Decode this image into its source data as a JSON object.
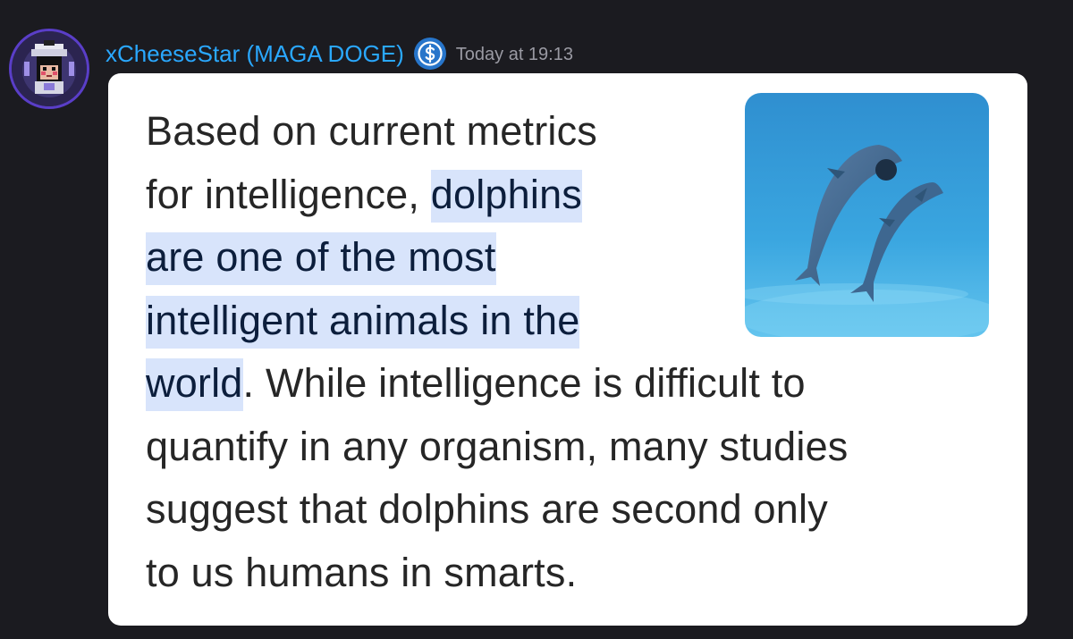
{
  "message": {
    "author": "xCheeseStar (MAGA DOGE)",
    "badge_icon": "usdc-dollar-badge-icon",
    "timestamp": "Today at 19:13",
    "avatar_icon": "pixel-astronaut-avatar-icon"
  },
  "snippet": {
    "line1": "Based on current metrics",
    "line2_plain": "for intelligence, ",
    "line2_hl": "dolphins",
    "line3_hl": "are one of the most",
    "line4_hl": "intelligent animals in the",
    "line5_hl": "world",
    "line5_plain": ". While intelligence is difficult to",
    "line6": "quantify in any organism, many studies",
    "line7": "suggest that dolphins are second only",
    "line8": "to us humans in smarts.",
    "image_icon": "dolphins-photo",
    "highlight_color": "#d8e4fb"
  },
  "colors": {
    "background": "#1b1b20",
    "username": "#2aa8ff",
    "timestamp": "#9a9aa3",
    "badge": "#2775ca"
  }
}
